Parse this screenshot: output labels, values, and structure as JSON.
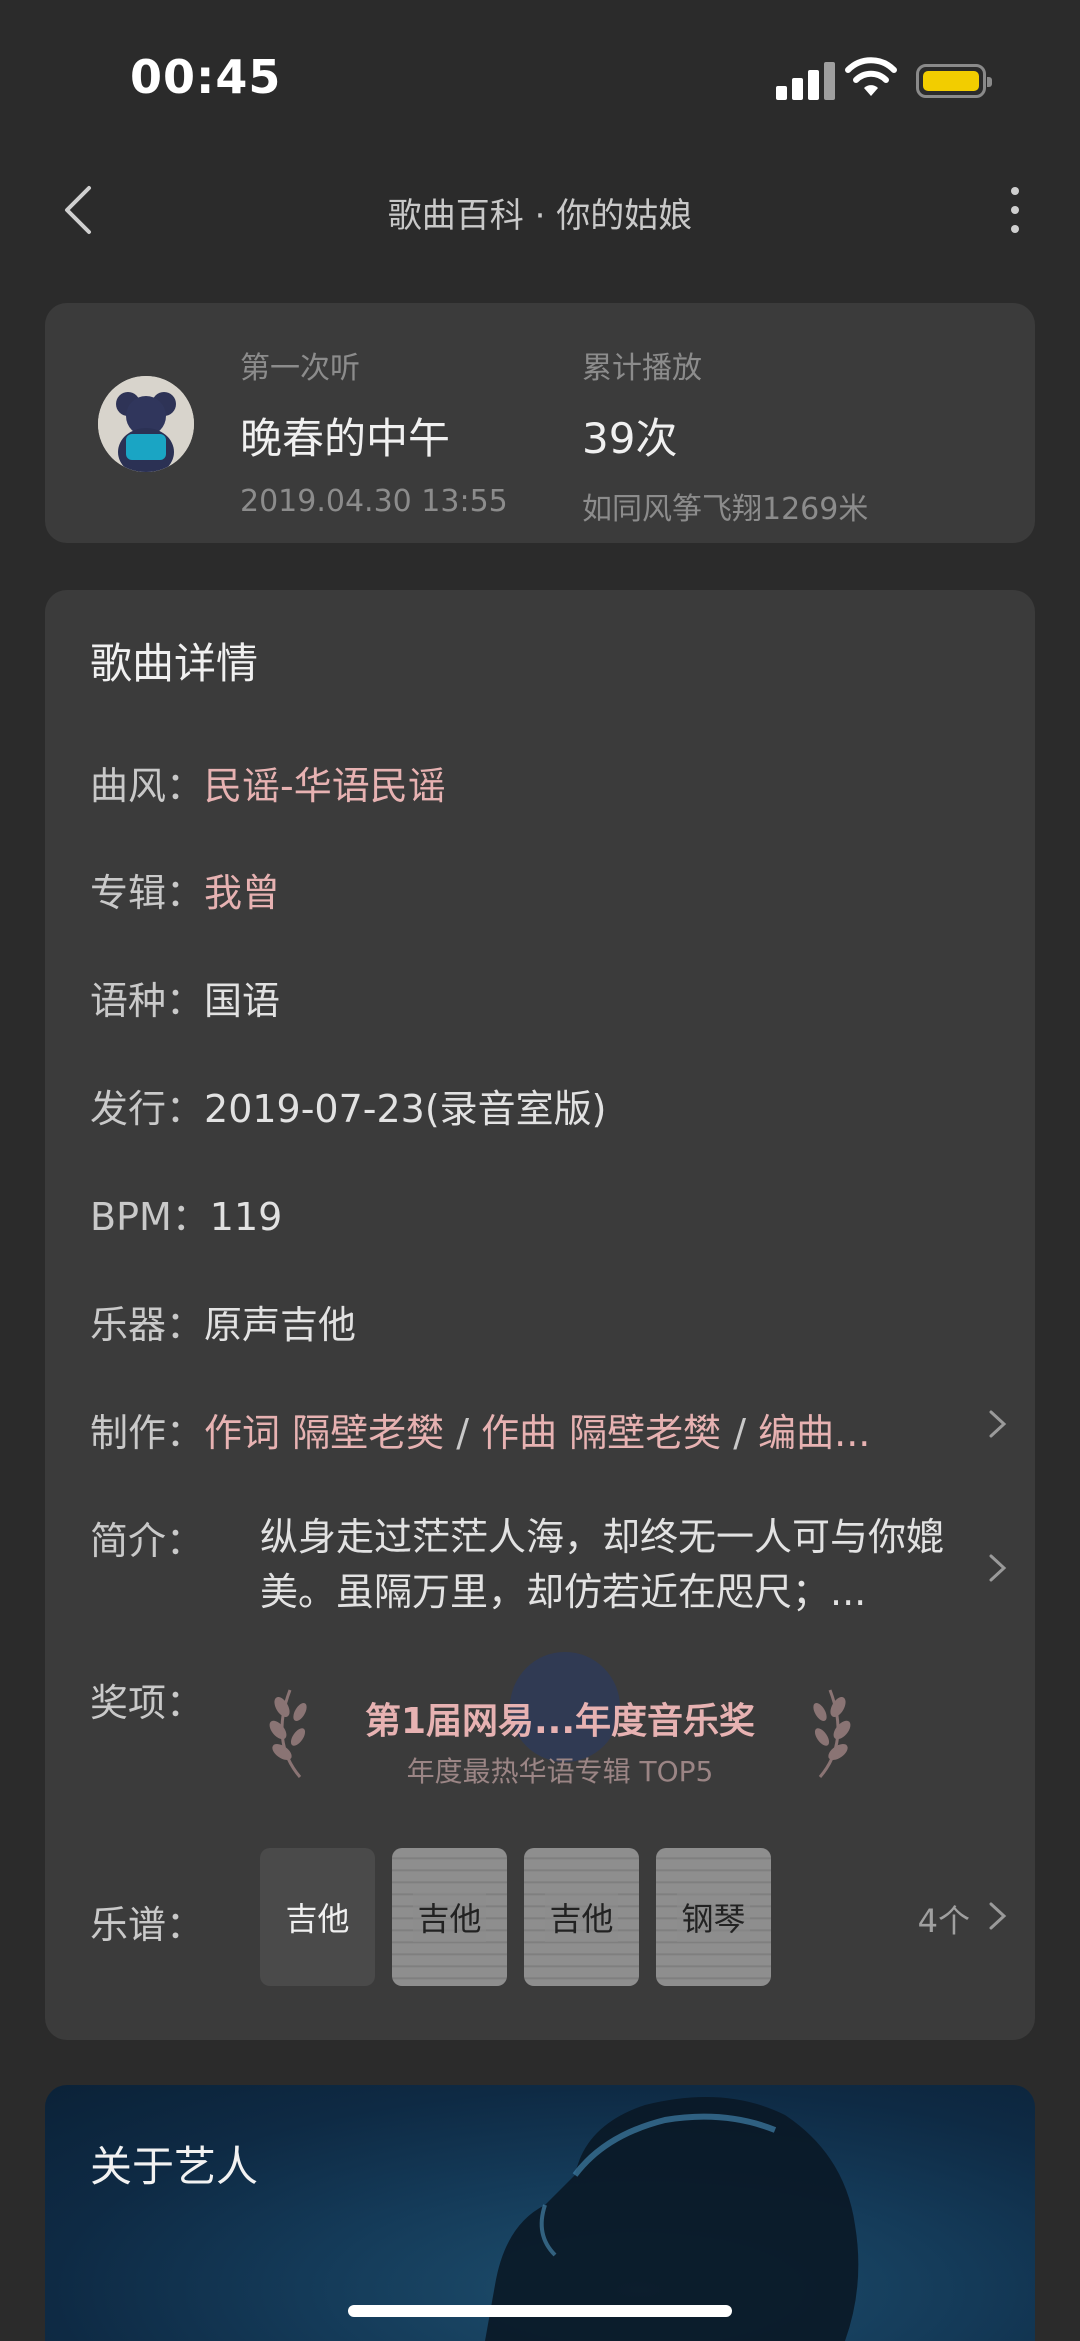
{
  "status_bar": {
    "time": "00:45"
  },
  "nav": {
    "title": "歌曲百科 · 你的姑娘"
  },
  "listen": {
    "first_label": "第一次听",
    "first_value": "晚春的中午",
    "first_date": "2019.04.30 13:55",
    "plays_label": "累计播放",
    "plays_value": "39次",
    "plays_sub": "如同风筝飞翔1269米"
  },
  "details": {
    "title": "歌曲详情",
    "genre": {
      "key": "曲风：",
      "value": "民谣-华语民谣"
    },
    "album": {
      "key": "专辑：",
      "value": "我曾"
    },
    "language": {
      "key": "语种：",
      "value": "国语"
    },
    "release": {
      "key": "发行：",
      "value": "2019-07-23(录音室版)"
    },
    "bpm": {
      "key": "BPM：",
      "value": "119"
    },
    "instrument": {
      "key": "乐器：",
      "value": "原声吉他"
    },
    "production": {
      "key": "制作：",
      "lyric": "作词 隔壁老樊",
      "sep1": " / ",
      "music": "作曲 隔壁老樊",
      "sep2": " / ",
      "arrange": "编曲..."
    },
    "intro": {
      "key": "简介：",
      "value": "纵身走过茫茫人海，却终无一人可与你媲美。虽隔万里，却仿若近在咫尺；..."
    },
    "award": {
      "key": "奖项：",
      "title": "第1届网易...年度音乐奖",
      "subtitle": "年度最热华语专辑 TOP5"
    },
    "scores": {
      "key": "乐谱：",
      "items": [
        "吉他",
        "吉他",
        "吉他",
        "钢琴"
      ],
      "count": "4个"
    }
  },
  "artist": {
    "title": "关于艺人"
  },
  "colors": {
    "accent_pink": "#e7b2b2",
    "card_bg": "#3b3b3b",
    "page_bg": "#2b2b2b"
  }
}
